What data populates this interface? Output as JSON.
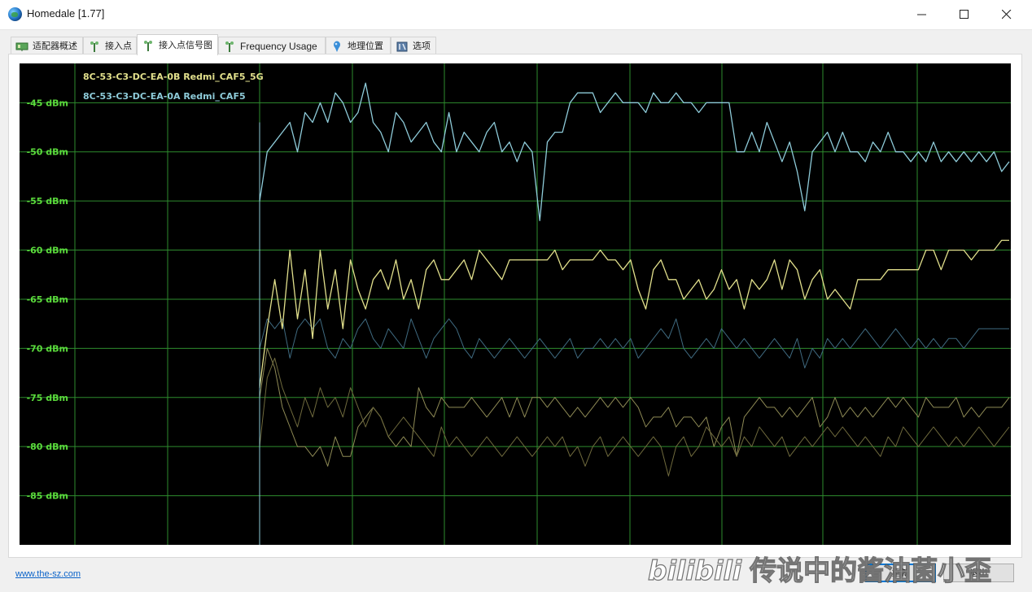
{
  "window": {
    "title": "Homedale [1.77]"
  },
  "tabs": [
    {
      "label": "适配器概述",
      "icon": "adapter-card-icon",
      "active": false
    },
    {
      "label": "接入点",
      "icon": "antenna-icon",
      "active": false
    },
    {
      "label": "接入点信号图",
      "icon": "antenna-signal-icon",
      "active": true
    },
    {
      "label": "Frequency Usage",
      "icon": "antenna-frequency-icon",
      "active": false
    },
    {
      "label": "地理位置",
      "icon": "map-pin-icon",
      "active": false
    },
    {
      "label": "选项",
      "icon": "settings-tools-icon",
      "active": false
    }
  ],
  "footer": {
    "link": "www.the-sz.com",
    "refresh_label": "重新",
    "exit_label": "退出"
  },
  "watermark": {
    "logo": "bilibili",
    "text": "传说中的酱油菌小歪"
  },
  "colors": {
    "background": "#000000",
    "grid": "#2e8b2e",
    "axis_label": "#5bdc3c",
    "series_5g": "#e2e08c",
    "series_24g": "#8ecbd9",
    "faint_series_1": "#8e8a55",
    "faint_series_2": "#3f6a80",
    "faint_series_3": "#6f6a3d"
  },
  "chart_data": {
    "type": "line",
    "title": "",
    "xlabel": "",
    "ylabel": "",
    "ylim": [
      -90,
      -41
    ],
    "yticks": [
      "-45 dBm",
      "-50 dBm",
      "-55 dBm",
      "-60 dBm",
      "-65 dBm",
      "-70 dBm",
      "-75 dBm",
      "-80 dBm",
      "-85 dBm"
    ],
    "ytick_values": [
      -45,
      -50,
      -55,
      -60,
      -65,
      -70,
      -75,
      -80,
      -85
    ],
    "grid": true,
    "legend_position": "top-left",
    "x_count": 100,
    "series": [
      {
        "name": "8C-53-C3-DC-EA-0B Redmi_CAF5_5G",
        "color": "#e2e08c",
        "values": [
          -74,
          -68,
          -63,
          -68,
          -60,
          -67,
          -62,
          -69,
          -60,
          -66,
          -62,
          -68,
          -61,
          -64,
          -66,
          -63,
          -62,
          -64,
          -61,
          -65,
          -63,
          -66,
          -62,
          -61,
          -63,
          -63,
          -62,
          -61,
          -63,
          -60,
          -61,
          -62,
          -63,
          -61,
          -61,
          -61,
          -61,
          -61,
          -61,
          -60,
          -62,
          -61,
          -61,
          -61,
          -61,
          -60,
          -61,
          -61,
          -62,
          -61,
          -64,
          -66,
          -62,
          -61,
          -63,
          -63,
          -65,
          -64,
          -63,
          -65,
          -64,
          -62,
          -64,
          -63,
          -66,
          -63,
          -64,
          -63,
          -61,
          -64,
          -61,
          -62,
          -65,
          -63,
          -62,
          -65,
          -64,
          -65,
          -66,
          -63,
          -63,
          -63,
          -63,
          -62,
          -62,
          -62,
          -62,
          -62,
          -60,
          -60,
          -62,
          -60,
          -60,
          -60,
          -61,
          -60,
          -60,
          -60,
          -59,
          -59
        ]
      },
      {
        "name": "8C-53-C3-DC-EA-0A Redmi_CAF5",
        "color": "#8ecbd9",
        "values": [
          -55,
          -50,
          -49,
          -48,
          -47,
          -50,
          -46,
          -47,
          -45,
          -47,
          -44,
          -45,
          -47,
          -46,
          -43,
          -47,
          -48,
          -50,
          -46,
          -47,
          -49,
          -48,
          -47,
          -49,
          -50,
          -46,
          -50,
          -48,
          -49,
          -50,
          -48,
          -47,
          -50,
          -49,
          -51,
          -49,
          -50,
          -57,
          -49,
          -48,
          -48,
          -45,
          -44,
          -44,
          -44,
          -46,
          -45,
          -44,
          -45,
          -45,
          -45,
          -46,
          -44,
          -45,
          -45,
          -44,
          -45,
          -45,
          -46,
          -45,
          -45,
          -45,
          -45,
          -50,
          -50,
          -48,
          -50,
          -47,
          -49,
          -51,
          -49,
          -52,
          -56,
          -50,
          -49,
          -48,
          -50,
          -48,
          -50,
          -50,
          -51,
          -49,
          -50,
          -48,
          -50,
          -50,
          -51,
          -50,
          -51,
          -49,
          -51,
          -50,
          -51,
          -50,
          -51,
          -50,
          -51,
          -50,
          -52,
          -51
        ]
      },
      {
        "name": "",
        "color": "#8e8a55",
        "values": [
          -75,
          -70,
          -72,
          -76,
          -78,
          -80,
          -80,
          -81,
          -80,
          -82,
          -79,
          -81,
          -81,
          -78,
          -77,
          -76,
          -77,
          -79,
          -80,
          -79,
          -80,
          -74,
          -76,
          -77,
          -75,
          -76,
          -76,
          -76,
          -75,
          -76,
          -77,
          -76,
          -75,
          -77,
          -75,
          -77,
          -75,
          -75,
          -76,
          -75,
          -76,
          -77,
          -76,
          -77,
          -76,
          -75,
          -76,
          -75,
          -76,
          -75,
          -76,
          -78,
          -77,
          -77,
          -76,
          -78,
          -77,
          -77,
          -78,
          -77,
          -80,
          -78,
          -77,
          -81,
          -77,
          -76,
          -75,
          -76,
          -76,
          -77,
          -76,
          -77,
          -76,
          -75,
          -78,
          -77,
          -75,
          -77,
          -76,
          -77,
          -76,
          -77,
          -76,
          -75,
          -76,
          -75,
          -76,
          -77,
          -75,
          -76,
          -76,
          -76,
          -75,
          -77,
          -76,
          -77,
          -76,
          -76,
          -76,
          -75
        ]
      },
      {
        "name": "",
        "color": "#3f6a80",
        "values": [
          -70,
          -67,
          -68,
          -67,
          -71,
          -68,
          -67,
          -68,
          -67,
          -70,
          -71,
          -69,
          -70,
          -68,
          -67,
          -69,
          -70,
          -68,
          -69,
          -70,
          -67,
          -69,
          -71,
          -69,
          -68,
          -67,
          -68,
          -70,
          -71,
          -69,
          -70,
          -71,
          -70,
          -69,
          -70,
          -71,
          -70,
          -69,
          -70,
          -71,
          -70,
          -69,
          -71,
          -70,
          -70,
          -69,
          -70,
          -69,
          -70,
          -69,
          -71,
          -70,
          -69,
          -68,
          -69,
          -67,
          -70,
          -71,
          -70,
          -69,
          -70,
          -68,
          -69,
          -70,
          -69,
          -70,
          -71,
          -70,
          -69,
          -70,
          -71,
          -69,
          -72,
          -70,
          -71,
          -69,
          -70,
          -69,
          -70,
          -69,
          -68,
          -69,
          -70,
          -69,
          -68,
          -69,
          -70,
          -69,
          -70,
          -69,
          -70,
          -69,
          -69,
          -70,
          -69,
          -68,
          -68,
          -68,
          -68,
          -68
        ]
      },
      {
        "name": "",
        "color": "#6f6a3d",
        "values": [
          -80,
          -73,
          -71,
          -74,
          -76,
          -78,
          -75,
          -77,
          -74,
          -76,
          -75,
          -77,
          -74,
          -76,
          -78,
          -76,
          -77,
          -79,
          -78,
          -77,
          -78,
          -79,
          -80,
          -81,
          -78,
          -80,
          -79,
          -80,
          -81,
          -80,
          -79,
          -80,
          -81,
          -80,
          -79,
          -80,
          -81,
          -80,
          -79,
          -80,
          -79,
          -81,
          -80,
          -82,
          -80,
          -79,
          -81,
          -80,
          -79,
          -80,
          -81,
          -80,
          -79,
          -80,
          -83,
          -80,
          -79,
          -81,
          -80,
          -78,
          -79,
          -80,
          -79,
          -81,
          -79,
          -80,
          -78,
          -79,
          -80,
          -79,
          -81,
          -80,
          -79,
          -80,
          -79,
          -78,
          -79,
          -78,
          -79,
          -80,
          -79,
          -80,
          -81,
          -79,
          -80,
          -78,
          -79,
          -80,
          -79,
          -78,
          -79,
          -80,
          -79,
          -80,
          -79,
          -78,
          -79,
          -80,
          -79,
          -78
        ]
      }
    ]
  }
}
